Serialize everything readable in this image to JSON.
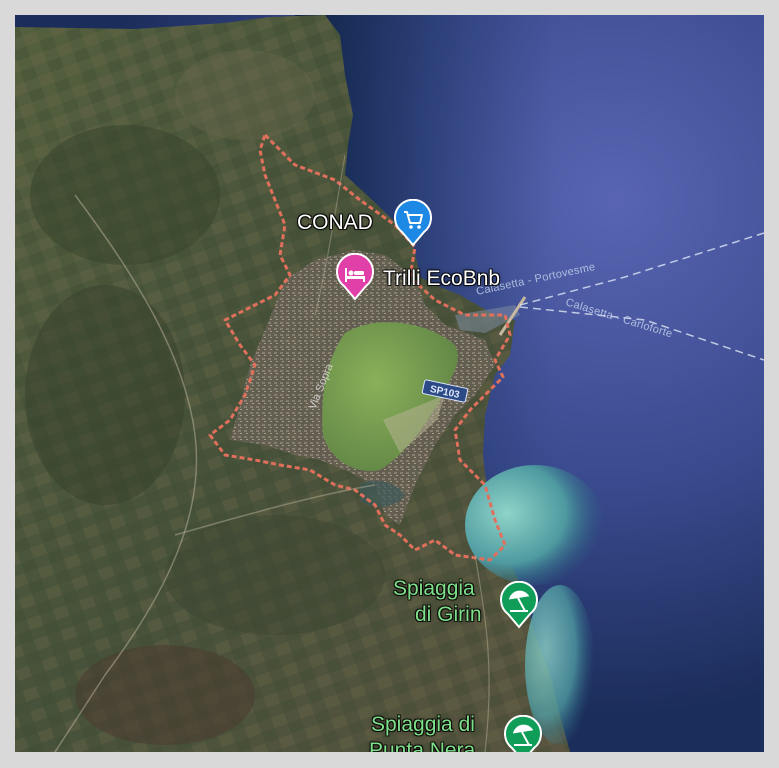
{
  "map": {
    "view": "satellite",
    "colors": {
      "deep_sea": "#22346a",
      "open_sea": "#4a5aa6",
      "land": "#4b5638",
      "town_boundary": "#e0705c",
      "lagoon": "#6f9a4a",
      "shallow_water": "#7fc4c0"
    },
    "markers": [
      {
        "id": "conad",
        "label": "CONAD",
        "icon": "shopping-cart-icon",
        "color": "#1e88e5"
      },
      {
        "id": "trilli",
        "label": "Trilli EcoBnb",
        "icon": "bed-icon",
        "color": "#e040a8"
      },
      {
        "id": "girin",
        "label_lines": [
          "Spiaggia",
          "di Girin"
        ],
        "icon": "beach-umbrella-icon",
        "color": "#0f9d58"
      },
      {
        "id": "punta",
        "label_lines": [
          "Spiaggia di",
          "Punta Nera"
        ],
        "icon": "beach-umbrella-icon",
        "color": "#0f9d58"
      }
    ],
    "ferry_routes": [
      "Calasetta - Portovesme",
      "Calasetta - Carloforte"
    ],
    "road_shield": "SP103",
    "street_label": "Via Sopra"
  }
}
